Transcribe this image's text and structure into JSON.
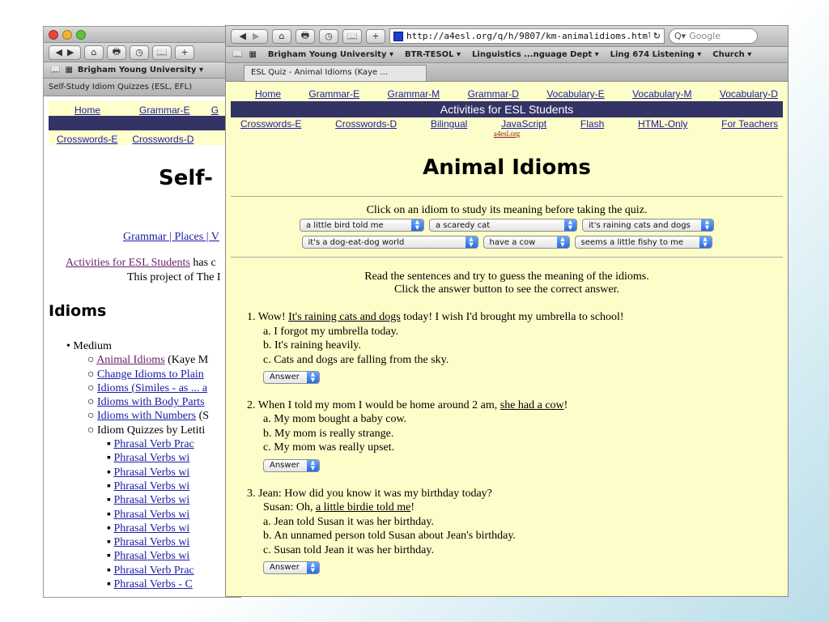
{
  "back_window": {
    "toolbar_buttons": [
      "◀",
      "▶",
      "⌂",
      "🖶",
      "◷",
      "📖",
      "+"
    ],
    "bookmark": "Brigham Young University ▾",
    "tab_title": "Self-Study Idiom Quizzes (ESL, EFL)",
    "nav_home": "Home",
    "nav_grammar": "Grammar-E",
    "nav_g": "G",
    "nav_crosswords_e": "Crosswords-E",
    "nav_crosswords_d": "Crosswords-D",
    "heading": "Self-",
    "links_line": "Grammar | Places | V",
    "activities_link": "Activities for ESL Students",
    "activities_rest": " has c",
    "project_line": "This project of The I",
    "idioms_heading": "Idioms",
    "medium_label": "Medium",
    "list_items": [
      {
        "link": "Animal Idioms",
        "rest": " (Kaye M"
      },
      {
        "link": "Change Idioms to Plain",
        "rest": ""
      },
      {
        "link": "Idioms (Similes - as ... a",
        "rest": ""
      },
      {
        "link": "Idioms with Body Parts",
        "rest": ""
      },
      {
        "link": "Idioms with Numbers",
        "rest": " (S"
      },
      {
        "link": "",
        "rest": "Idiom Quizzes by Letiti"
      }
    ],
    "sub_items": [
      "Phrasal Verb Prac",
      "Phrasal Verbs wi",
      "Phrasal Verbs wi",
      "Phrasal Verbs wi",
      "Phrasal Verbs wi",
      "Phrasal Verbs wi",
      "Phrasal Verbs wi",
      "Phrasal Verbs wi",
      "Phrasal Verbs wi",
      "Phrasal Verb Prac",
      "Phrasal Verbs - C"
    ]
  },
  "front_window": {
    "url": "http://a4esl.org/q/h/9807/km-animalidioms.html",
    "reload_icon": "↻",
    "search_placeholder": "Google",
    "bookmarks": [
      "Brigham Young University ▾",
      "BTR-TESOL ▾",
      "Linguistics ...nguage Dept ▾",
      "Ling 674 Listening ▾",
      "Church ▾"
    ],
    "tab_title": "ESL Quiz - Animal Idioms (Kaye ...",
    "nav_top": [
      "Home",
      "Grammar-E",
      "Grammar-M",
      "Grammar-D",
      "Vocabulary-E",
      "Vocabulary-M",
      "Vocabulary-D"
    ],
    "band_title": "Activities for ESL Students",
    "nav_bottom": [
      "Crosswords-E",
      "Crosswords-D",
      "Bilingual",
      "JavaScript",
      "Flash",
      "HTML-Only",
      "For Teachers"
    ],
    "credit": "a4esl.org",
    "page_title": "Animal Idioms",
    "study_instruction": "Click on an idiom to study its meaning before taking the quiz.",
    "idiom_menus_row1": [
      "a little bird told me",
      "a scaredy cat",
      "it's raining cats and dogs"
    ],
    "idiom_menus_row2": [
      "it's a dog-eat-dog world",
      "have a cow",
      "seems a little fishy to me"
    ],
    "read_instruction_1": "Read the sentences and try to guess the meaning of the idioms.",
    "read_instruction_2": "Click the answer button to see the correct answer.",
    "answer_label": "Answer",
    "questions": [
      {
        "number": "1.",
        "pre": "Wow! ",
        "idiom": "It's raining cats and dogs",
        "post": " today! I wish I'd brought my umbrella to school!",
        "options": [
          "a. I forgot my umbrella today.",
          "b. It's raining heavily.",
          "c. Cats and dogs are falling from the sky."
        ]
      },
      {
        "number": "2.",
        "pre": "When I told my mom I would be home around 2 am, ",
        "idiom": "she had a cow",
        "post": "!",
        "options": [
          "a. My mom bought a baby cow.",
          "b. My mom is really strange.",
          "c. My mom was really upset."
        ]
      },
      {
        "number": "3.",
        "pre": "Jean: How did you know it was my birthday today?",
        "line2_pre": "Susan: Oh, ",
        "idiom": "a little birdie told me",
        "post": "!",
        "options": [
          "a. Jean told Susan it was her birthday.",
          "b. An unnamed person told Susan about Jean's birthday.",
          "c. Susan told Jean it was her birthday."
        ]
      }
    ]
  }
}
